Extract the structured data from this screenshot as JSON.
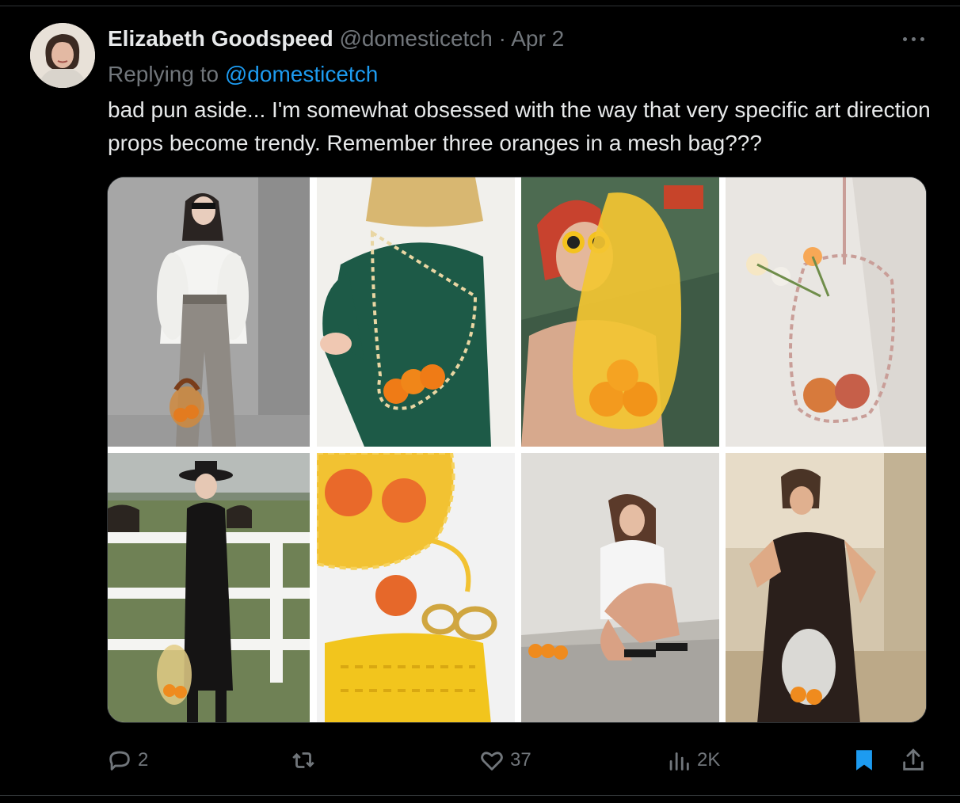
{
  "tweet": {
    "author_name": "Elizabeth Goodspeed",
    "author_handle": "@domesticetch",
    "separator": "·",
    "date": "Apr 2",
    "reply_prefix": "Replying to",
    "reply_handle": "@domesticetch",
    "text": "bad pun aside... I'm somewhat obsessed with the way that very specific art direction props become trendy. Remember three oranges in a mesh bag???"
  },
  "actions": {
    "replies": "2",
    "retweets": "",
    "likes": "37",
    "views": "2K"
  },
  "icons": {
    "reply": "reply-bubble-icon",
    "retweet": "retweet-icon",
    "like": "heart-icon",
    "views": "bar-chart-icon",
    "bookmark": "bookmark-icon",
    "share": "share-icon",
    "more": "more-dots-icon"
  },
  "colors": {
    "background": "#000000",
    "text": "#e7e9ea",
    "muted": "#71767b",
    "link": "#1d9bf0",
    "bookmark_active": "#1d9bf0"
  }
}
